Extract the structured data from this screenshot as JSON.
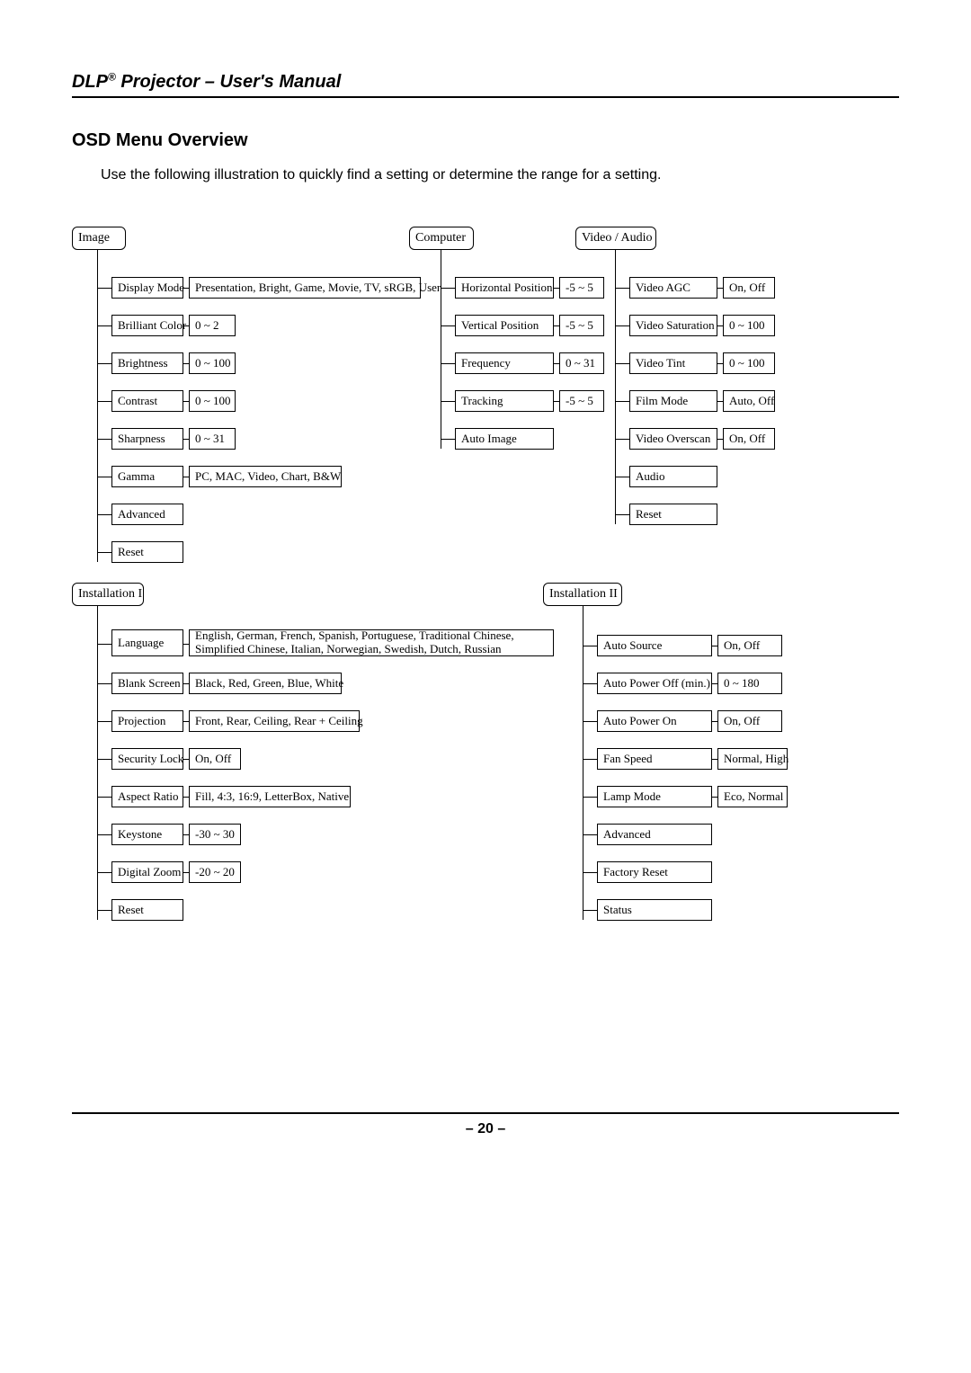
{
  "header": {
    "prefix": "DLP",
    "reg": "®",
    "rest": " Projector – User's Manual"
  },
  "section_title": "OSD Menu Overview",
  "intro": "Use the following illustration to quickly find a setting or determine the range for a setting.",
  "page_number": "– 20 –",
  "menus": {
    "image": {
      "title": "Image",
      "items": [
        {
          "label": "Display Mode",
          "value": "Presentation, Bright, Game, Movie, TV, sRGB, User"
        },
        {
          "label": "Brilliant Color",
          "value": "0 ~ 2"
        },
        {
          "label": "Brightness",
          "value": "0 ~ 100"
        },
        {
          "label": "Contrast",
          "value": "0 ~ 100"
        },
        {
          "label": "Sharpness",
          "value": "0 ~ 31"
        },
        {
          "label": "Gamma",
          "value": "PC, MAC, Video, Chart, B&W"
        },
        {
          "label": "Advanced",
          "value": null
        },
        {
          "label": "Reset",
          "value": null
        }
      ]
    },
    "computer": {
      "title": "Computer",
      "items": [
        {
          "label": "Horizontal Position",
          "value": "-5 ~ 5"
        },
        {
          "label": "Vertical Position",
          "value": "-5 ~ 5"
        },
        {
          "label": "Frequency",
          "value": "0 ~ 31"
        },
        {
          "label": "Tracking",
          "value": "-5 ~ 5"
        },
        {
          "label": "Auto Image",
          "value": null
        }
      ]
    },
    "video_audio": {
      "title": "Video / Audio",
      "items": [
        {
          "label": "Video AGC",
          "value": "On, Off"
        },
        {
          "label": "Video Saturation",
          "value": "0 ~ 100"
        },
        {
          "label": "Video Tint",
          "value": "0 ~ 100"
        },
        {
          "label": "Film Mode",
          "value": "Auto, Off"
        },
        {
          "label": "Video Overscan",
          "value": "On, Off"
        },
        {
          "label": "Audio",
          "value": null
        },
        {
          "label": "Reset",
          "value": null
        }
      ]
    },
    "installation1": {
      "title": "Installation I",
      "items": [
        {
          "label": "Language",
          "value": "English, German, French, Spanish, Portuguese, Traditional Chinese, Simplified Chinese, Italian, Norwegian, Swedish, Dutch, Russian"
        },
        {
          "label": "Blank Screen",
          "value": "Black, Red, Green, Blue, White"
        },
        {
          "label": "Projection",
          "value": "Front, Rear, Ceiling, Rear + Ceiling"
        },
        {
          "label": "Security Lock",
          "value": "On, Off"
        },
        {
          "label": "Aspect Ratio",
          "value": "Fill, 4:3, 16:9, LetterBox, Native"
        },
        {
          "label": "Keystone",
          "value": "-30 ~ 30"
        },
        {
          "label": "Digital Zoom",
          "value": "-20 ~ 20"
        },
        {
          "label": "Reset",
          "value": null
        }
      ]
    },
    "installation2": {
      "title": "Installation II",
      "items": [
        {
          "label": "Auto Source",
          "value": "On, Off"
        },
        {
          "label": "Auto Power Off (min.)",
          "value": "0 ~ 180"
        },
        {
          "label": "Auto Power On",
          "value": "On, Off"
        },
        {
          "label": "Fan Speed",
          "value": "Normal, High"
        },
        {
          "label": "Lamp Mode",
          "value": "Eco, Normal"
        },
        {
          "label": "Advanced",
          "value": null
        },
        {
          "label": "Factory Reset",
          "value": null
        },
        {
          "label": "Status",
          "value": null
        }
      ]
    }
  }
}
